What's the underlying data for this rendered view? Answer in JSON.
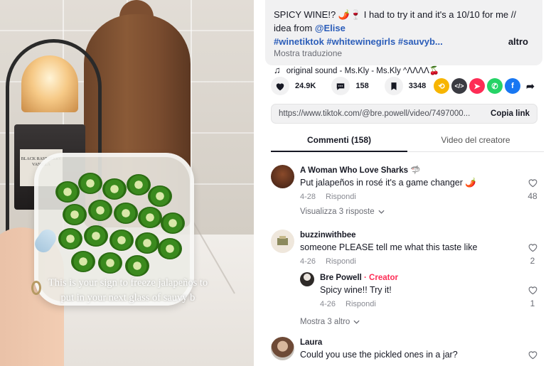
{
  "video": {
    "caption": "This is your sign to freeze jalapeños to put in your next glass of sauvy b",
    "candle_label": "BLACK RASPBERRY VANILLA"
  },
  "description": {
    "text_prefix": "SPICY WINE!? 🌶️🍷 I had to try it and it's a 10/10 for me // idea from ",
    "mention": "@Elise",
    "hashtags": [
      "#winetiktok",
      "#whitewinegirls",
      "#sauvyb..."
    ],
    "more_label": "altro",
    "translate_label": "Mostra traduzione",
    "sound": "original sound - Ms.Kly - Ms.Kly ^ᐱᐱᐱᐱ🍒"
  },
  "actions": {
    "likes": "24.9K",
    "comments": "158",
    "saves": "3348",
    "share_icons": [
      {
        "name": "repost-icon",
        "color": "#f7b500"
      },
      {
        "name": "embed-icon",
        "color": "#3a3b42"
      },
      {
        "name": "send-icon",
        "color": "#fe2c55"
      },
      {
        "name": "whatsapp-icon",
        "color": "#25d366"
      },
      {
        "name": "facebook-icon",
        "color": "#1877f2"
      },
      {
        "name": "share-arrow-icon",
        "color": "#161823"
      }
    ]
  },
  "link": {
    "url": "https://www.tiktok.com/@bre.powell/video/7497000...",
    "copy_label": "Copia link"
  },
  "tabs": [
    "Commenti (158)",
    "Video del creatore"
  ],
  "comments": [
    {
      "user": "A Woman Who Love Sharks 🦈",
      "text": "Put jalapeños in rosé it's a game changer 🌶️",
      "date": "4-28",
      "reply_label": "Rispondi",
      "likes": "48",
      "more": "Visualizza 3 risposte"
    },
    {
      "user": "buzzinwithbee",
      "text": "someone PLEASE tell me what this taste like",
      "date": "4-26",
      "reply_label": "Rispondi",
      "likes": "2",
      "reply": {
        "user": "Bre Powell",
        "badge": "· Creator",
        "text": "Spicy wine!! Try it!",
        "date": "4-26",
        "reply_label": "Rispondi",
        "likes": "1"
      },
      "more": "Mostra 3 altro"
    },
    {
      "user": "Laura",
      "text": "Could you use the pickled ones in a jar?"
    }
  ]
}
